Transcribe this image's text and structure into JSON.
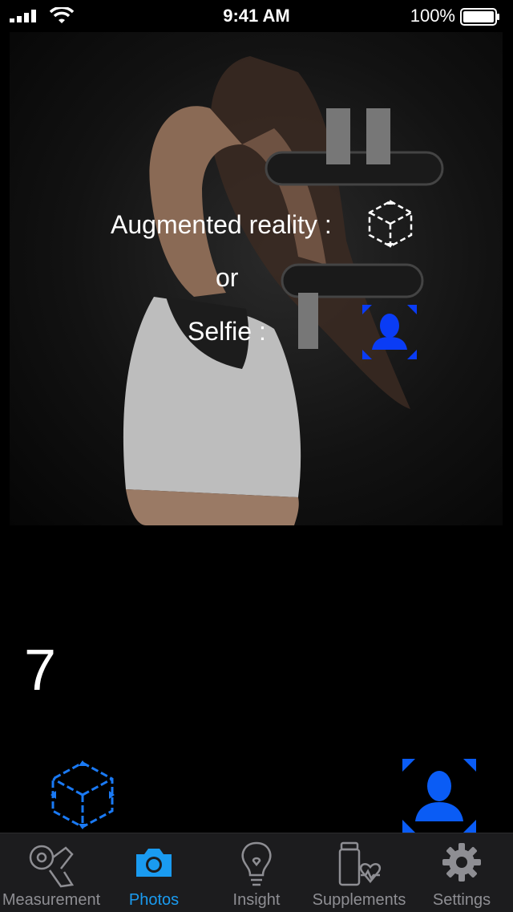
{
  "status_bar": {
    "time": "9:41 AM",
    "battery": "100%"
  },
  "hero": {
    "ar_label": "Augmented reality :",
    "or_label": "or",
    "selfie_label": "Selfie :"
  },
  "counter": {
    "value": "7"
  },
  "tabs": [
    {
      "label": "Measurement",
      "icon": "measuring-tape-icon"
    },
    {
      "label": "Photos",
      "icon": "camera-icon",
      "active": true
    },
    {
      "label": "Insight",
      "icon": "lightbulb-icon"
    },
    {
      "label": "Supplements",
      "icon": "supplements-heart-icon"
    },
    {
      "label": "Settings",
      "icon": "gear-icon"
    }
  ],
  "colors": {
    "accent": "#1a9bf0",
    "selfie_blue": "#0a3cf5",
    "background": "#000000",
    "tab_bar": "#1c1c1e"
  }
}
